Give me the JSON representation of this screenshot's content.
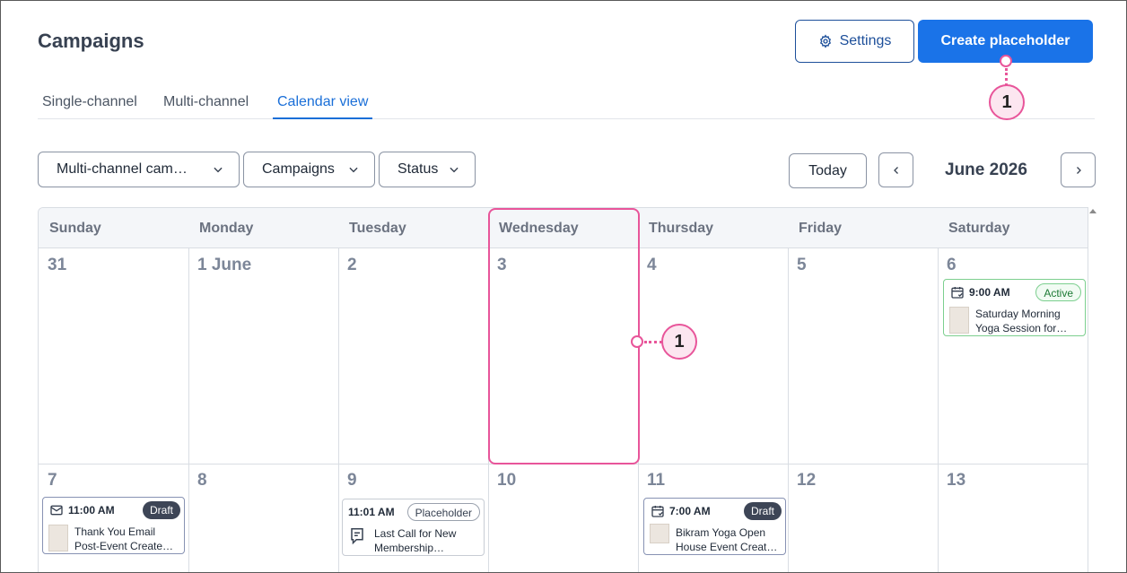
{
  "header": {
    "title": "Campaigns",
    "settings_label": "Settings",
    "create_label": "Create placeholder"
  },
  "tabs": [
    {
      "label": "Single-channel",
      "active": false
    },
    {
      "label": "Multi-channel",
      "active": false
    },
    {
      "label": "Calendar view",
      "active": true
    }
  ],
  "filters": {
    "type": "Multi-channel cam…",
    "campaigns": "Campaigns",
    "status": "Status"
  },
  "nav": {
    "today": "Today",
    "month": "June 2026"
  },
  "weekdays": [
    "Sunday",
    "Monday",
    "Tuesday",
    "Wednesday",
    "Thursday",
    "Friday",
    "Saturday"
  ],
  "days": {
    "w1": [
      "31",
      "1 June",
      "2",
      "3",
      "4",
      "5",
      "6"
    ],
    "w2": [
      "7",
      "8",
      "9",
      "10",
      "11",
      "12",
      "13"
    ]
  },
  "events": {
    "sat6": {
      "time": "9:00 AM",
      "status": "Active",
      "title1": "Saturday Morning",
      "title2": "Yoga Session for…",
      "icon": "calendar-event-icon"
    },
    "sun7": {
      "time": "11:00 AM",
      "status": "Draft",
      "title1": "Thank You Email",
      "title2": "Post-Event Created…",
      "icon": "email-icon"
    },
    "tue9": {
      "time": "11:01 AM",
      "status": "Placeholder",
      "title1": "Last Call for New",
      "title2": "Membership…",
      "icon": "placeholder-note-icon"
    },
    "thu11": {
      "time": "7:00 AM",
      "status": "Draft",
      "title1": "Bikram Yoga Open",
      "title2": "House Event Creat…",
      "icon": "calendar-event-icon"
    }
  },
  "callouts": {
    "one": "1"
  },
  "colors": {
    "accent": "#1a73e8",
    "highlight": "#e8559a",
    "active_green": "#1d7a35",
    "draft_dark": "#3d4556"
  }
}
